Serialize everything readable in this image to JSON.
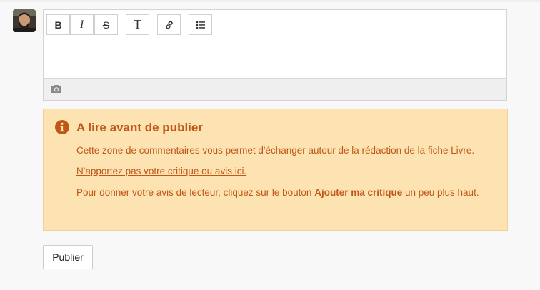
{
  "toolbar": {
    "bold_icon": "bold-icon",
    "italic_icon": "italic-icon",
    "strike_icon": "strikethrough-icon",
    "text_icon": "text-format-icon",
    "link_icon": "link-icon",
    "list_icon": "bullet-list-icon",
    "bold_label": "B",
    "italic_label": "I",
    "strike_label": "S",
    "text_label": "T"
  },
  "editor": {
    "value": "",
    "attachment_icon": "camera-icon"
  },
  "notice": {
    "icon": "info-icon",
    "title": "A lire avant de publier",
    "line1": "Cette zone de commentaires vous permet d'échanger autour de la rédaction de la fiche Livre.",
    "line2": "N'apportez pas votre critique ou avis ici.",
    "line3_before": "Pour donner votre avis de lecteur, cliquez sur le bouton ",
    "line3_bold": "Ajouter ma critique",
    "line3_after": " un peu plus haut."
  },
  "actions": {
    "publish_label": "Publier"
  },
  "colors": {
    "notice_bg": "#fde3b1",
    "notice_text": "#c05717"
  }
}
